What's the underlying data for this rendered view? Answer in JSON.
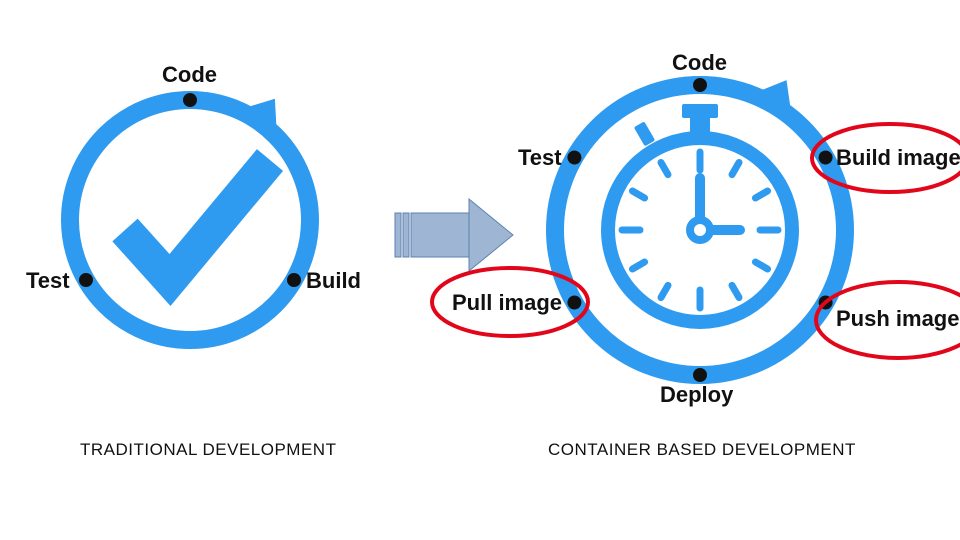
{
  "colors": {
    "blue": "#2F9BF0",
    "arrow_fill": "#9EB6D3",
    "arrow_stroke": "#5C82B2",
    "red": "#E2061A",
    "black": "#111111"
  },
  "left": {
    "caption": "TRADITIONAL DEVELOPMENT",
    "nodes": {
      "code": "Code",
      "build": "Build",
      "test": "Test"
    }
  },
  "right": {
    "caption": "CONTAINER BASED DEVELOPMENT",
    "nodes": {
      "code": "Code",
      "build_image": "Build image",
      "push_image": "Push image",
      "deploy": "Deploy",
      "pull_image": "Pull image",
      "test": "Test"
    }
  }
}
